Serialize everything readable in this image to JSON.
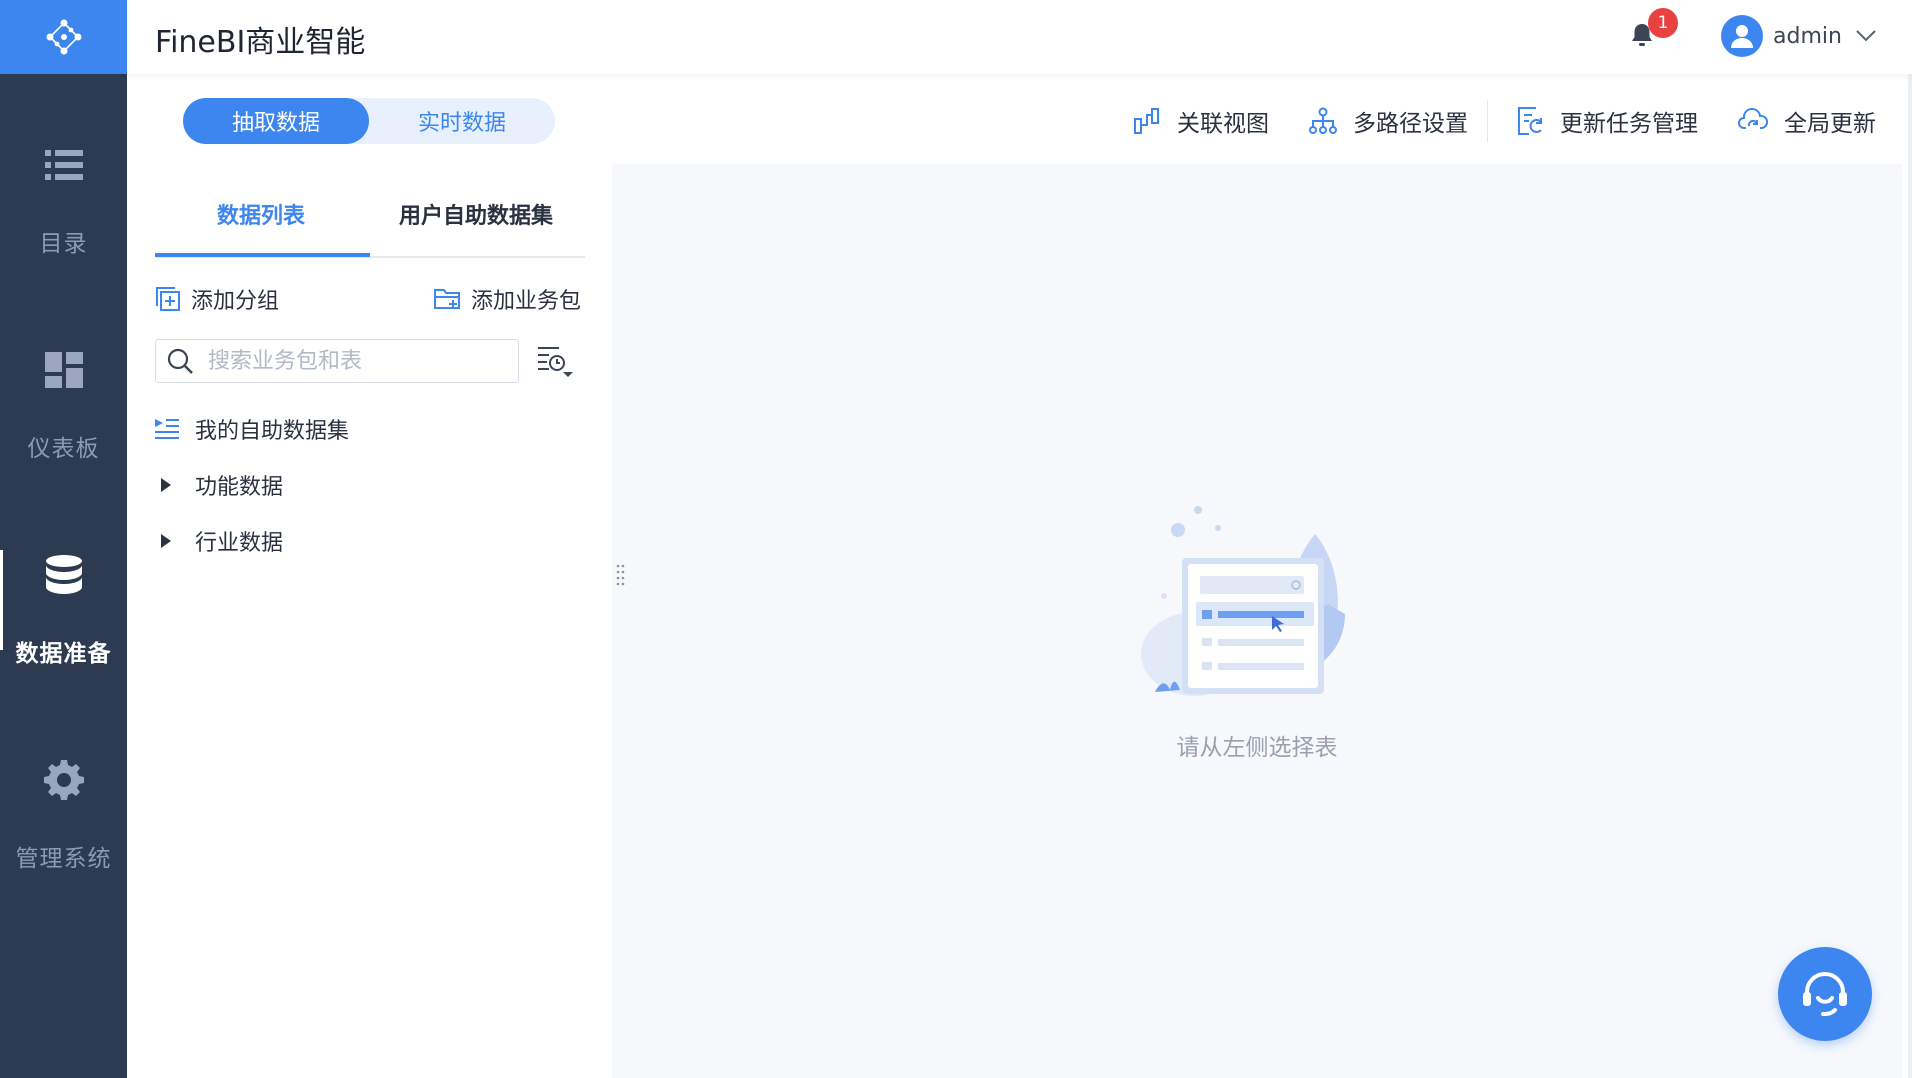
{
  "app": {
    "title": "FineBI商业智能"
  },
  "header": {
    "notification_count": "1",
    "username": "admin"
  },
  "sidenav": {
    "items": [
      {
        "label": "目录",
        "icon": "list-icon"
      },
      {
        "label": "仪表板",
        "icon": "dashboard-icon"
      },
      {
        "label": "数据准备",
        "icon": "database-icon",
        "active": true
      },
      {
        "label": "管理系统",
        "icon": "gear-icon"
      }
    ]
  },
  "mode_toggle": {
    "extract": "抽取数据",
    "realtime": "实时数据",
    "selected": "抽取数据"
  },
  "toolbar": {
    "relation_view": "关联视图",
    "multipath": "多路径设置",
    "update_tasks": "更新任务管理",
    "global_update": "全局更新"
  },
  "left_panel": {
    "tabs": [
      "数据列表",
      "用户自助数据集"
    ],
    "active_tab": "数据列表",
    "add_group": "添加分组",
    "add_package": "添加业务包",
    "search_placeholder": "搜索业务包和表",
    "tree": [
      {
        "label": "我的自助数据集",
        "icon": "self-dataset-icon"
      },
      {
        "label": "功能数据",
        "icon": "caret-right-icon"
      },
      {
        "label": "行业数据",
        "icon": "caret-right-icon"
      }
    ]
  },
  "content": {
    "empty_text": "请从左侧选择表"
  },
  "colors": {
    "accent": "#3d86f0",
    "sidebar": "#2c3a52",
    "badge": "#e8413f"
  }
}
